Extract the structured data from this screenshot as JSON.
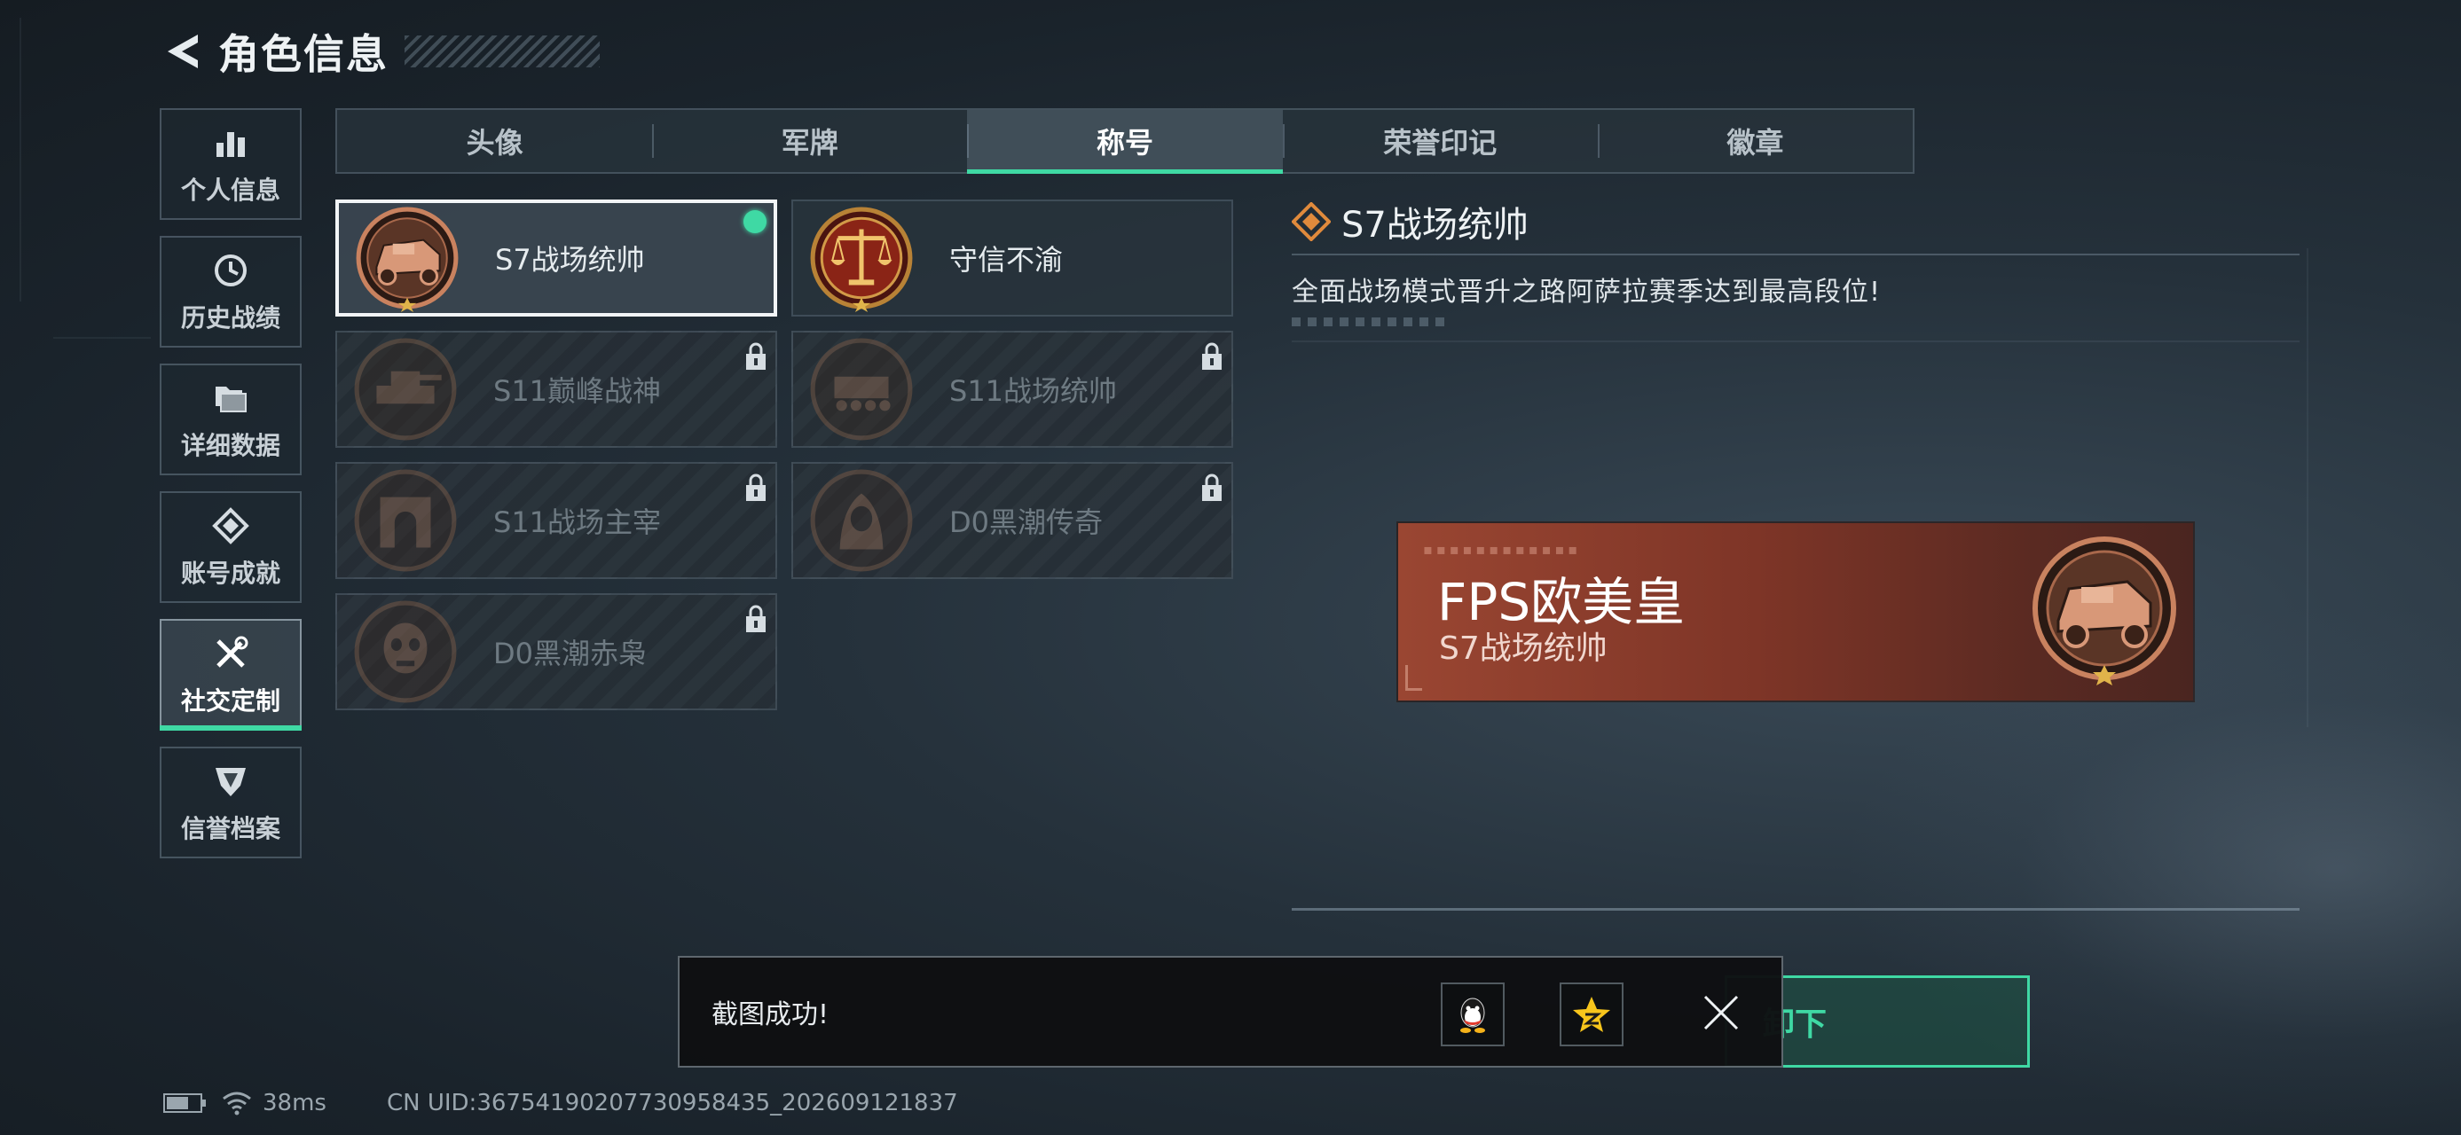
{
  "header": {
    "title": "角色信息",
    "back_icon": "back-arrow-icon"
  },
  "sidenav": {
    "items": [
      {
        "label": "个人信息",
        "icon": "bar-chart-icon",
        "active": false
      },
      {
        "label": "历史战绩",
        "icon": "clock-icon",
        "active": false
      },
      {
        "label": "详细数据",
        "icon": "folder-icon",
        "active": false
      },
      {
        "label": "账号成就",
        "icon": "achievement-icon",
        "active": false
      },
      {
        "label": "社交定制",
        "icon": "tools-icon",
        "active": true
      },
      {
        "label": "信誉档案",
        "icon": "shield-icon",
        "active": false
      }
    ]
  },
  "tabs": [
    {
      "label": "头像",
      "active": false
    },
    {
      "label": "军牌",
      "active": false
    },
    {
      "label": "称号",
      "active": true
    },
    {
      "label": "荣誉印记",
      "active": false
    },
    {
      "label": "徽章",
      "active": false
    }
  ],
  "titles": [
    {
      "label": "S7战场统帅",
      "locked": false,
      "selected": true,
      "equipped": true,
      "badge": "armored-vehicle-badge"
    },
    {
      "label": "守信不渝",
      "locked": false,
      "selected": false,
      "equipped": false,
      "badge": "scales-badge"
    },
    {
      "label": "S11巅峰战神",
      "locked": true,
      "selected": false,
      "equipped": false,
      "badge": "tank-badge"
    },
    {
      "label": "S11战场统帅",
      "locked": true,
      "selected": false,
      "equipped": false,
      "badge": "tracked-vehicle-badge"
    },
    {
      "label": "S11战场主宰",
      "locked": true,
      "selected": false,
      "equipped": false,
      "badge": "arch-badge"
    },
    {
      "label": "D0黑潮传奇",
      "locked": true,
      "selected": false,
      "equipped": false,
      "badge": "hooded-figure-badge"
    },
    {
      "label": "D0黑潮赤枭",
      "locked": true,
      "selected": false,
      "equipped": false,
      "badge": "skull-mask-badge"
    }
  ],
  "detail": {
    "title": "S7战场统帅",
    "description": "全面战场模式晋升之路阿萨拉赛季达到最高段位!"
  },
  "nameplate": {
    "player_name": "FPS欧美皇",
    "title": "S7战场统帅"
  },
  "unequip_button": {
    "label": "卸下"
  },
  "toast": {
    "message": "截图成功!",
    "share_qq_icon": "qq-penguin-icon",
    "share_qzone_icon": "qzone-star-icon",
    "close_icon": "close-icon"
  },
  "status": {
    "ping": "38ms",
    "uid": "CN UID:3675419020773095843​5_202609121837"
  },
  "colors": {
    "accent": "#3fd9a4",
    "nameplate_bg": "#8a3d2d",
    "badge_bronze": "#c9825f"
  }
}
